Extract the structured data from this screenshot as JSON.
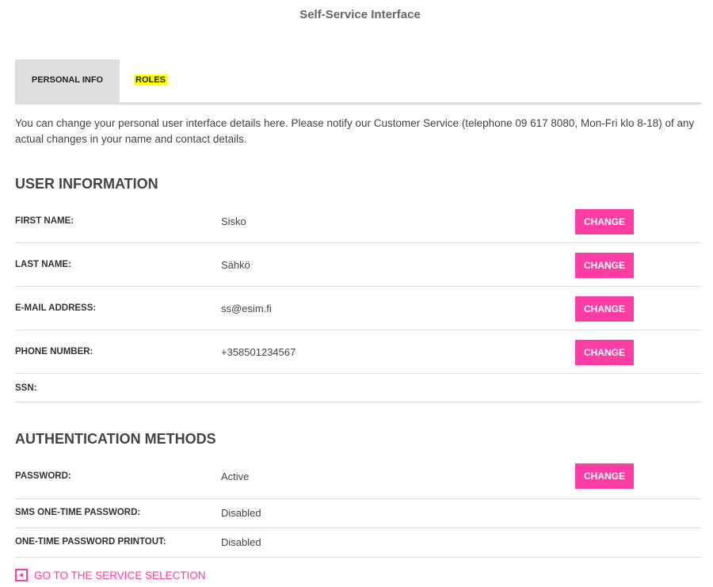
{
  "page": {
    "title": "Self-Service Interface"
  },
  "tabs": [
    {
      "label": "PERSONAL INFO",
      "active": true
    },
    {
      "label": "ROLES",
      "active": false
    }
  ],
  "intro": "You can change your personal user interface details here. Please notify our Customer Service (telephone 09 617 8080, Mon-Fri klo 8-18) of any actual changes in your name and contact details.",
  "user_info": {
    "heading": "USER INFORMATION",
    "rows": [
      {
        "label": "FIRST NAME:",
        "value": "Sisko",
        "button": "CHANGE"
      },
      {
        "label": "LAST NAME:",
        "value": "Sähkö",
        "button": "CHANGE"
      },
      {
        "label": "E-MAIL ADDRESS:",
        "value": "ss@esim.fi",
        "button": "CHANGE"
      },
      {
        "label": "PHONE NUMBER:",
        "value": "+358501234567",
        "button": "CHANGE"
      },
      {
        "label": "SSN:",
        "value": ""
      }
    ]
  },
  "auth": {
    "heading": "AUTHENTICATION METHODS",
    "rows": [
      {
        "label": "PASSWORD:",
        "value": "Active",
        "button": "CHANGE"
      },
      {
        "label": "SMS ONE-TIME PASSWORD:",
        "value": "Disabled"
      },
      {
        "label": "ONE-TIME PASSWORD PRINTOUT:",
        "value": "Disabled"
      }
    ]
  },
  "footer": {
    "back_link": "GO TO THE SERVICE SELECTION",
    "back_icon": "arrow-left-icon"
  },
  "colors": {
    "accent": "#ff3ca4",
    "highlight": "#ffff00",
    "tab_active_bg": "#dedede"
  }
}
